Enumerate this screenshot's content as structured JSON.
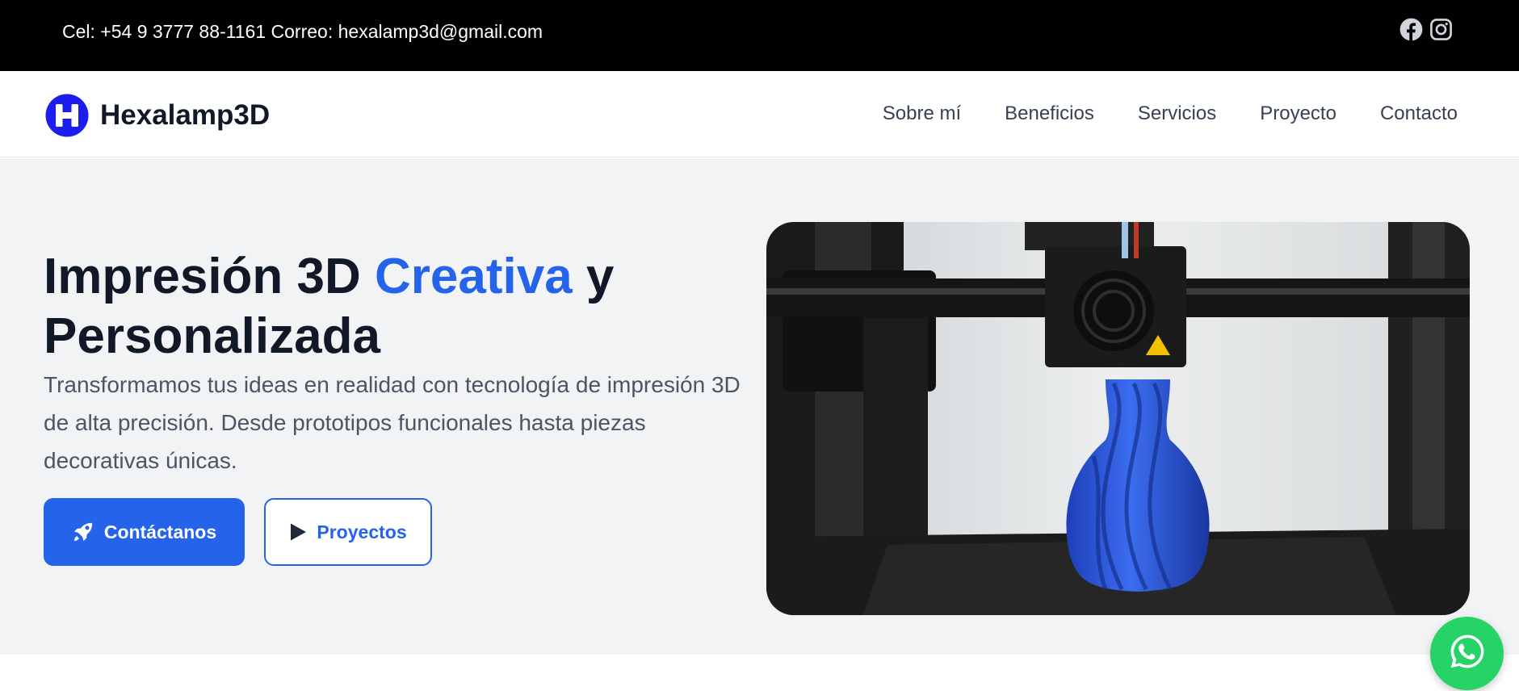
{
  "topbar": {
    "contact_text": "Cel: +54 9 3777 88-1161 Correo: hexalamp3d@gmail.com",
    "social_icons": [
      "facebook-icon",
      "instagram-icon"
    ]
  },
  "navbar": {
    "brand_name": "Hexalamp3D",
    "logo_icon": "hexalamp-h-logo",
    "links": [
      "Sobre mí",
      "Beneficios",
      "Servicios",
      "Proyecto",
      "Contacto"
    ]
  },
  "hero": {
    "title_part1": "Impresión 3D ",
    "title_accent": "Creativa",
    "title_part2": " y Personalizada",
    "subtitle": "Transformamos tus ideas en realidad con tecnología de impresión 3D de alta precisión. Desde prototipos funcionales hasta piezas decorativas únicas.",
    "primary_button": {
      "label": "Contáctanos",
      "icon": "rocket-icon"
    },
    "secondary_button": {
      "label": "Proyectos",
      "icon": "play-icon"
    },
    "image": "3d-printer-printing-blue-vase"
  },
  "floating": {
    "whatsapp_icon": "whatsapp-icon"
  },
  "colors": {
    "accent": "#2563eb",
    "topbar_bg": "#000000",
    "hero_bg": "#f2f3f5",
    "whatsapp": "#25d366"
  }
}
